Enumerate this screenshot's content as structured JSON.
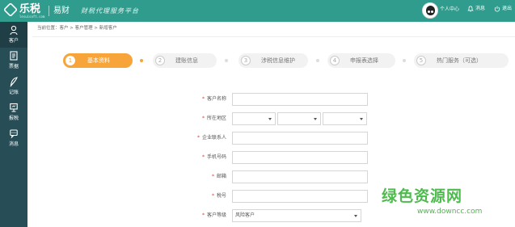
{
  "header": {
    "logo_text": "乐税",
    "logo_sub": "lesuisoft.com",
    "brand_name": "易财",
    "slogan": "财税代理服务平台",
    "user_label": "个人中心",
    "message_label": "消息",
    "logout_label": "退出"
  },
  "sidebar": {
    "items": [
      {
        "label": "客户",
        "icon": "person-icon"
      },
      {
        "label": "票据",
        "icon": "document-icon"
      },
      {
        "label": "记账",
        "icon": "feather-pen-icon"
      },
      {
        "label": "报税",
        "icon": "monitor-icon"
      },
      {
        "label": "消息",
        "icon": "chat-icon"
      }
    ],
    "active_index": 0
  },
  "breadcrumb": "当前位置：客户 > 客户管理 > 新增客户",
  "steps": [
    {
      "num": "1",
      "label": "基本资料",
      "active": true
    },
    {
      "num": "2",
      "label": "建账信息",
      "active": false
    },
    {
      "num": "3",
      "label": "涉税信息维护",
      "active": false
    },
    {
      "num": "4",
      "label": "申报表选择",
      "active": false
    },
    {
      "num": "5",
      "label": "热门服务（可选）",
      "active": false
    }
  ],
  "form": {
    "customer_name_label": "客户名称",
    "region_label": "所在地区",
    "contact_label": "企业联系人",
    "phone_label": "手机号码",
    "email_label": "邮箱",
    "tax_id_label": "税号",
    "level_label": "客户等级",
    "level_value": "风险客户",
    "required_mark": "*"
  },
  "watermark": {
    "title": "绿色资源网",
    "url": "www.downcc.com"
  },
  "colors": {
    "header_bg": "#2f9c8d",
    "sidebar_bg": "#274d57",
    "step_active": "#f7a53a",
    "required": "#ee3333",
    "watermark": "#3cb43c"
  }
}
